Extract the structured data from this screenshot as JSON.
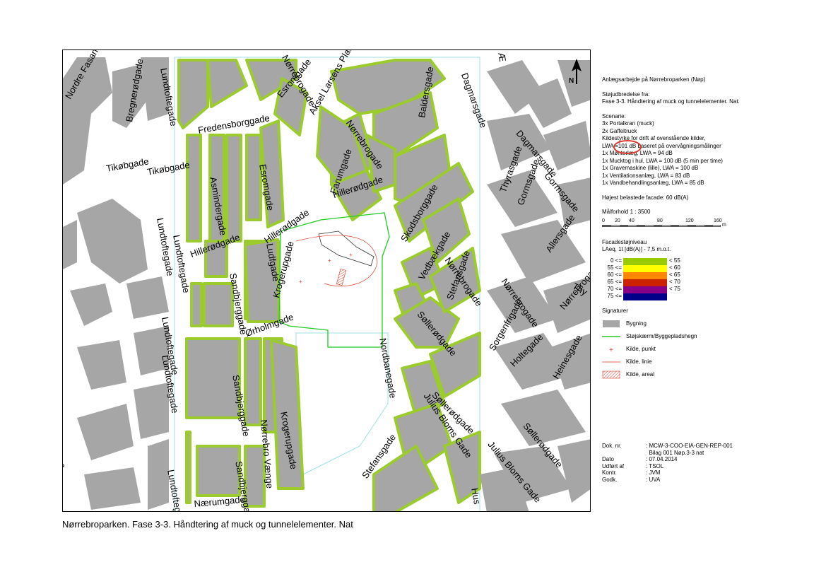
{
  "caption": "Nørrebroparken. Fase 3-3. Håndtering af muck og tunnelelementer. Nat",
  "colors": {
    "building": "#a6a6a6",
    "facade_green": "#9bcb2d",
    "screen_line": "#22cc22",
    "source": "#e03a2a",
    "annotation_circle": "#e03a2a"
  },
  "map": {
    "north_label": "N",
    "streets": [
      "Nordre Fasan",
      "Bregnerødgade",
      "Lundtoftegade",
      "Esromgade",
      "Nørrebrogade",
      "Aksel Larsens Plads",
      "Baldersgade",
      "Dagmarsgade",
      "Fredensborggade",
      "Tikøbgade",
      "Tikøbgade",
      "Farumgade",
      "Nørrebrogade",
      "Esromgade",
      "Asmindergade",
      "Hillerødgade",
      "Hillerødgade",
      "Lundtoftegade",
      "Ludfgade",
      "Thyrasgade",
      "Dagmarsgade",
      "Gormsgade",
      "Gormsgade",
      "Allersgade",
      "Skodsborggade",
      "Vedbækgade",
      "Nørrebrogade",
      "Lundtoftegade",
      "Lundtoftegade",
      "Hillerødgade",
      "Krogerupgade",
      "Sandbjerggade",
      "Ørholmgade",
      "Stefansgade",
      "Sorgenfrigade",
      "Nørrebrogade",
      "Nørrebrogade",
      "Søllerødgade",
      "Holtegade",
      "Heinesgade",
      "Nordbanegade",
      "Søllerødgade",
      "Lundtoftegade",
      "Sandbjerggade",
      "Nørrebro Vænge",
      "Krogerupgade",
      "Julius Bloms Gade",
      "Søllerødgade",
      "Stefansgade",
      "Julius Bloms Gade",
      "Sandbjerggade",
      "Lundtoftegade",
      "Nærumgade",
      "Hus",
      "Thy",
      "Æ",
      "en"
    ]
  },
  "legend": {
    "project": "Anlægsarbejde på Nørrebroparken (Nøp)",
    "assessment_heading": "Støjudbredelse fra:",
    "assessment_text": "Fase 3-3. Håndtering af muck og tunnelelementer. Nat.",
    "scenario_heading": "Scenarie:",
    "scenario_lines": [
      "3x Portalkran (muck)",
      "2x Gaffeltruck",
      "Kildestyrke for drift af ovenstående kilder,",
      "LWA =101 dB baseret på overvågningsmålinger",
      "1x Mønterlæg, LWA = 94 dB",
      "1x Mucktog i hul, LWA = 100 dB (5 min per time)",
      "1x Gravemaskine (lille), LWA = 100 dB",
      "1x Ventilationsanlæg, LWA = 83 dB",
      "1x Vandbehandlingsanlæg, LWA = 85 dB"
    ],
    "max_facade": "Højest belastede facade: 60 dB(A)",
    "scale_label": "Målforhold 1 : 3500",
    "scale_ticks": [
      "0",
      "20",
      "40",
      "80",
      "120",
      "160"
    ],
    "scale_unit": "m",
    "facade_heading": "Facadestøjniveau",
    "facade_sub": "LAeq, 1t [dB(A)] - 7,5 m.o.t.",
    "noise_classes": [
      {
        "lo": "0 <=",
        "hi": "< 55",
        "color": "#99cc00"
      },
      {
        "lo": "55 <=",
        "hi": "< 60",
        "color": "#ffff00"
      },
      {
        "lo": "60 <=",
        "hi": "< 65",
        "color": "#ff8800"
      },
      {
        "lo": "65 <=",
        "hi": "< 70",
        "color": "#cc2200"
      },
      {
        "lo": "70 <=",
        "hi": "< 75",
        "color": "#880088"
      },
      {
        "lo": "75 <=",
        "hi": "",
        "color": "#000088"
      }
    ],
    "signatures_heading": "Signaturer",
    "signatures": [
      {
        "label": "Bygning",
        "kind": "building"
      },
      {
        "label": "Støjskærm/Byggepladshegn",
        "kind": "screen"
      },
      {
        "label": "Kilde, punkt",
        "kind": "point"
      },
      {
        "label": "Kilde, linie",
        "kind": "line"
      },
      {
        "label": "Kilde, areal",
        "kind": "area"
      }
    ]
  },
  "docinfo": {
    "rows": [
      {
        "k": "Dok. nr.",
        "v": ": MCW-3-COO-EIA-GEN-REP-001"
      },
      {
        "k": "",
        "v": "  Bilag 001 Nøp.3-3 nat"
      },
      {
        "k": "Dato",
        "v": ": 07.04.2014"
      },
      {
        "k": "Udført af",
        "v": ": TSOL"
      },
      {
        "k": "Kontr.",
        "v": ": JVM"
      },
      {
        "k": "Godk.",
        "v": ": UVA"
      }
    ]
  }
}
